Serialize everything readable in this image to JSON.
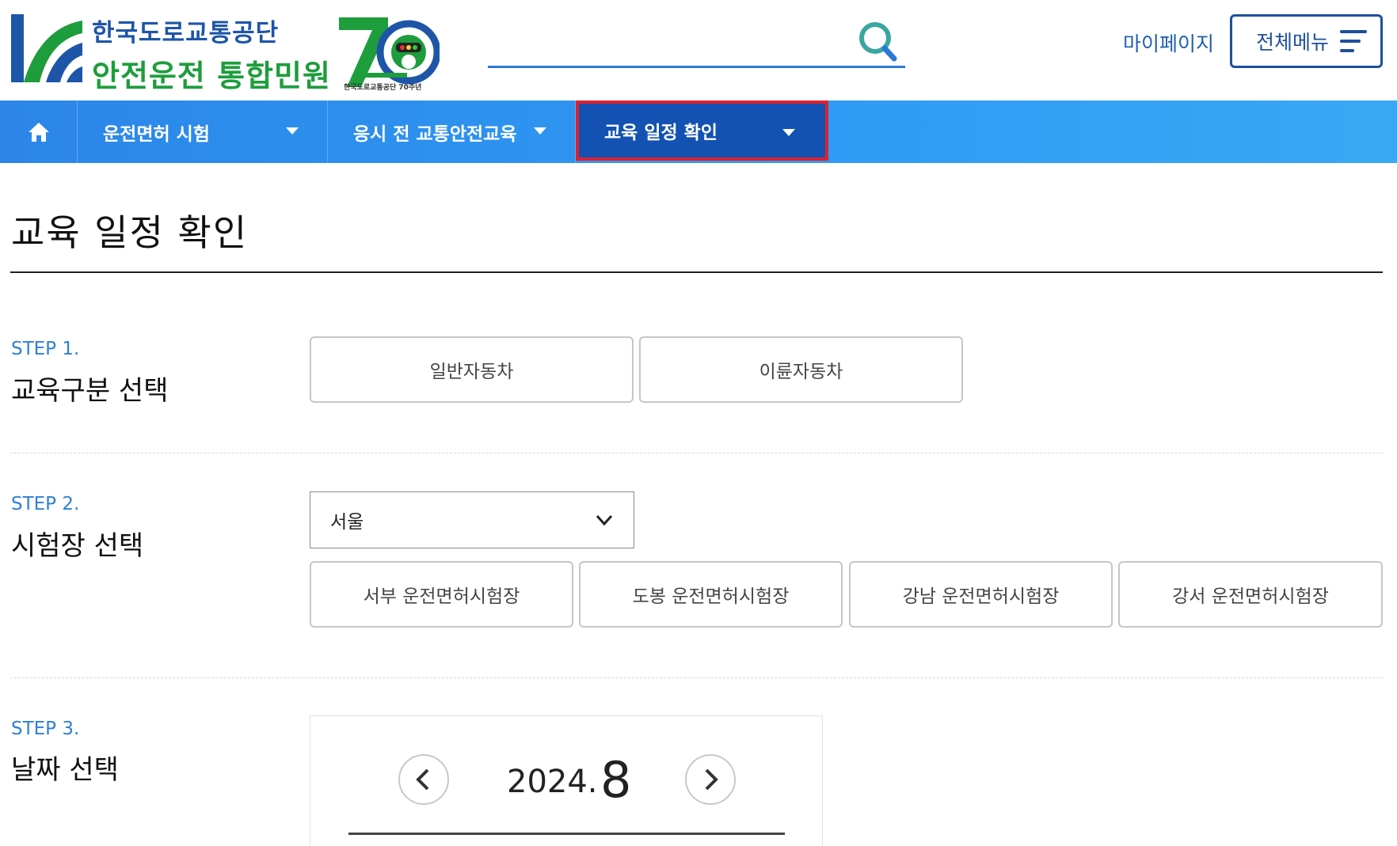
{
  "header": {
    "logo_line1": "한국도로교통공단",
    "logo_line2": "안전운전 통합민원",
    "anniversary_caption": "한국도로교통공단 70주년",
    "search_placeholder": "",
    "mypage_label": "마이페이지",
    "allmenu_label": "전체메뉴"
  },
  "nav": {
    "items": [
      {
        "label": "운전면허 시험"
      },
      {
        "label": "응시 전 교통안전교육"
      },
      {
        "label": "교육 일정 확인"
      }
    ]
  },
  "main": {
    "page_title": "교육 일정 확인",
    "step1": {
      "step_label": "STEP 1.",
      "title": "교육구분 선택",
      "options": [
        "일반자동차",
        "이륜자동차"
      ]
    },
    "step2": {
      "step_label": "STEP 2.",
      "title": "시험장 선택",
      "region_selected": "서울",
      "centers": [
        "서부 운전면허시험장",
        "도봉 운전면허시험장",
        "강남 운전면허시험장",
        "강서 운전면허시험장"
      ]
    },
    "step3": {
      "step_label": "STEP 3.",
      "title": "날짜 선택",
      "year": "2024.",
      "month": "8"
    }
  },
  "colors": {
    "nav_bg": "#2f93f0",
    "nav_active": "#1352b3",
    "highlight_border": "#e0202e",
    "step_blue": "#2f7fd6",
    "logo_blue": "#1e55a8",
    "logo_green": "#1e9d3c"
  }
}
